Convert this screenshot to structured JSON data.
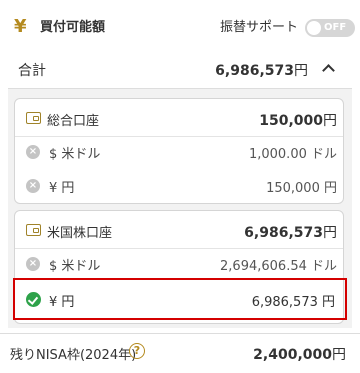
{
  "header": {
    "icon": "yen-icon",
    "title": "買付可能額",
    "furikae_label": "振替サポート",
    "toggle_label": "OFF"
  },
  "total": {
    "label": "合計",
    "amount": "6,986,573",
    "unit": "円"
  },
  "accounts": [
    {
      "title": "総合口座",
      "amount": "150,000",
      "unit": "円",
      "rows": [
        {
          "currency_symbol": "$",
          "label": "米ドル",
          "value": "1,000.00 ドル",
          "selected": false
        },
        {
          "currency_symbol": "¥",
          "label": "円",
          "value": "150,000 円",
          "selected": false
        }
      ]
    },
    {
      "title": "米国株口座",
      "amount": "6,986,573",
      "unit": "円",
      "rows": [
        {
          "currency_symbol": "$",
          "label": "米ドル",
          "value": "2,694,606.54 ドル",
          "selected": false
        },
        {
          "currency_symbol": "¥",
          "label": "円",
          "value": "6,986,573 円",
          "selected": true
        }
      ]
    }
  ],
  "nisa": {
    "label": "残りNISA枠(2024年)",
    "amount": "2,400,000",
    "unit": "円"
  },
  "colors": {
    "accent_gold": "#b48a1f",
    "selected_border": "#d40000",
    "check_green": "#2ea24a"
  }
}
